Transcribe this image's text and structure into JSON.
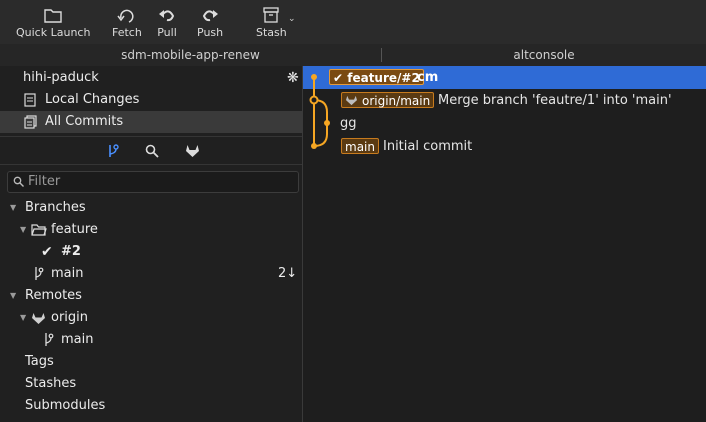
{
  "toolbar": {
    "quick_launch": "Quick Launch",
    "fetch": "Fetch",
    "pull": "Pull",
    "push": "Push",
    "stash": "Stash"
  },
  "tabs": [
    "sdm-mobile-app-renew",
    "altconsole"
  ],
  "sidebar": {
    "repo_name": "hihi-paduck",
    "local_changes": "Local Changes",
    "all_commits": "All Commits",
    "filter_placeholder": "Filter",
    "branches_header": "Branches",
    "feature_folder": "feature",
    "feature_branch": "#2",
    "main_branch": "main",
    "main_behind": "2↓",
    "remotes_header": "Remotes",
    "origin_remote": "origin",
    "origin_main": "main",
    "tags": "Tags",
    "stashes": "Stashes",
    "submodules": "Submodules"
  },
  "commits": [
    {
      "badge": "feature/#2",
      "message": "cm"
    },
    {
      "badge": "origin/main",
      "message": "Merge branch 'feautre/1' into 'main'"
    },
    {
      "badge": "",
      "message": "gg"
    },
    {
      "badge": "main",
      "message": "Initial commit"
    }
  ],
  "colors": {
    "accent": "#2f6bd6",
    "graph": "#f5a623",
    "badge_border": "#c77b1e"
  },
  "icons": [
    "folder-icon",
    "fetch-icon",
    "pull-icon",
    "push-icon",
    "stash-icon",
    "settings-icon",
    "document-icon",
    "commits-icon",
    "branch-icon",
    "search-icon",
    "gitlab-icon",
    "folder-open-icon",
    "checkmark-icon"
  ]
}
